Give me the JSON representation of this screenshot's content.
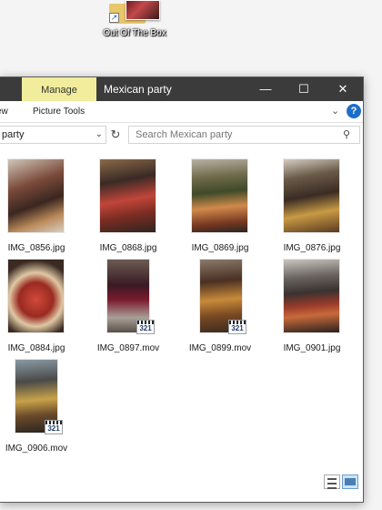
{
  "desktop": {
    "icon_label": "Out Of The Box"
  },
  "window": {
    "title": "Mexican party",
    "manage_tab": "Manage",
    "buttons": {
      "minimize": "—",
      "maximize": "☐",
      "close": "✕"
    }
  },
  "ribbon": {
    "tab_view": "ew",
    "tab_picture_tools": "Picture Tools",
    "help": "?"
  },
  "address": {
    "path": "party",
    "search_placeholder": "Search Mexican party"
  },
  "files": [
    {
      "name": "IMG_0856.jpg",
      "type": "jpg"
    },
    {
      "name": "IMG_0868.jpg",
      "type": "jpg"
    },
    {
      "name": "IMG_0869.jpg",
      "type": "jpg"
    },
    {
      "name": "IMG_0876.jpg",
      "type": "jpg"
    },
    {
      "name": "IMG_0884.jpg",
      "type": "jpg"
    },
    {
      "name": "IMG_0897.mov",
      "type": "mov"
    },
    {
      "name": "IMG_0899.mov",
      "type": "mov"
    },
    {
      "name": "IMG_0901.jpg",
      "type": "jpg"
    },
    {
      "name": "IMG_0906.mov",
      "type": "mov"
    }
  ],
  "video_badge_text": "321"
}
